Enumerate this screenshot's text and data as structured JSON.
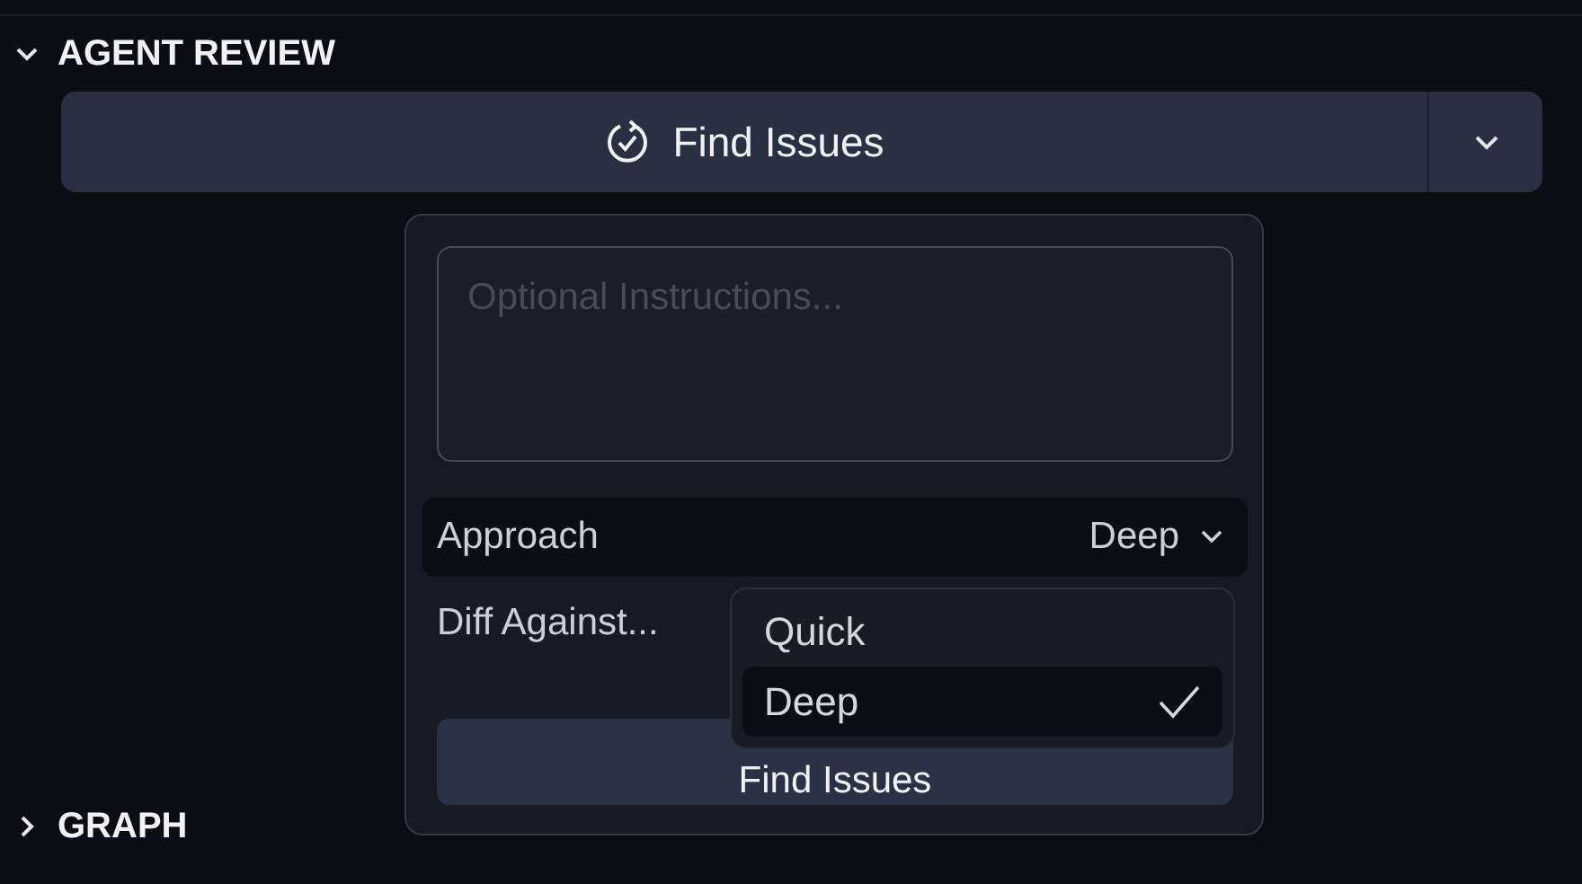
{
  "sections": [
    {
      "title": "AGENT REVIEW",
      "expanded": true
    },
    {
      "title": "GRAPH",
      "expanded": false
    }
  ],
  "main_button": {
    "label": "Find Issues"
  },
  "popover": {
    "instructions": {
      "placeholder": "Optional Instructions..."
    },
    "settings": [
      {
        "label": "Approach",
        "value": "Deep",
        "highlighted": true
      },
      {
        "label": "Diff Against...",
        "highlighted": false
      }
    ],
    "submit": {
      "label": "Find Issues"
    }
  },
  "menu": [
    {
      "label": "Quick",
      "selected": false
    },
    {
      "label": "Deep",
      "selected": true
    }
  ]
}
